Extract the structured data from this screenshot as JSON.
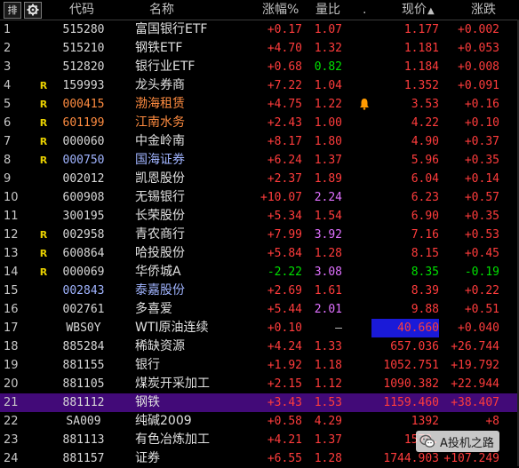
{
  "header": {
    "sort_button": "排",
    "settings_icon": "gear-icon",
    "code": "代码",
    "name": "名称",
    "pct": "涨幅%",
    "vol_ratio": "量比",
    "dot": ".",
    "price": "现价",
    "price_sort_icon": "▲",
    "change": "涨跌"
  },
  "rows": [
    {
      "num": "1",
      "flag": "",
      "code": "515280",
      "code_color": "normal",
      "name": "富国银行ETF",
      "name_color": "normal",
      "pct": "+0.17",
      "pct_dir": "up",
      "vol": "1.07",
      "vol_dir": "up",
      "alert": false,
      "price": "1.177",
      "price_dir": "up",
      "chg": "+0.002",
      "chg_dir": "up"
    },
    {
      "num": "2",
      "flag": "",
      "code": "515210",
      "code_color": "normal",
      "name": "钢铁ETF",
      "name_color": "normal",
      "pct": "+4.70",
      "pct_dir": "up",
      "vol": "1.32",
      "vol_dir": "up",
      "alert": false,
      "price": "1.181",
      "price_dir": "up",
      "chg": "+0.053",
      "chg_dir": "up"
    },
    {
      "num": "3",
      "flag": "",
      "code": "512820",
      "code_color": "normal",
      "name": "银行业ETF",
      "name_color": "normal",
      "pct": "+0.68",
      "pct_dir": "up",
      "vol": "0.82",
      "vol_dir": "down",
      "alert": false,
      "price": "1.184",
      "price_dir": "up",
      "chg": "+0.008",
      "chg_dir": "up"
    },
    {
      "num": "4",
      "flag": "R",
      "code": "159993",
      "code_color": "normal",
      "name": "龙头券商",
      "name_color": "normal",
      "pct": "+7.22",
      "pct_dir": "up",
      "vol": "1.04",
      "vol_dir": "up",
      "alert": false,
      "price": "1.352",
      "price_dir": "up",
      "chg": "+0.091",
      "chg_dir": "up"
    },
    {
      "num": "5",
      "flag": "R",
      "code": "000415",
      "code_color": "orange",
      "name": "渤海租赁",
      "name_color": "orange",
      "pct": "+4.75",
      "pct_dir": "up",
      "vol": "1.22",
      "vol_dir": "up",
      "alert": true,
      "price": "3.53",
      "price_dir": "up",
      "chg": "+0.16",
      "chg_dir": "up"
    },
    {
      "num": "6",
      "flag": "R",
      "code": "601199",
      "code_color": "orange",
      "name": "江南水务",
      "name_color": "orange",
      "pct": "+2.43",
      "pct_dir": "up",
      "vol": "1.00",
      "vol_dir": "up",
      "alert": false,
      "price": "4.22",
      "price_dir": "up",
      "chg": "+0.10",
      "chg_dir": "up"
    },
    {
      "num": "7",
      "flag": "R",
      "code": "000060",
      "code_color": "normal",
      "name": "中金岭南",
      "name_color": "normal",
      "pct": "+8.17",
      "pct_dir": "up",
      "vol": "1.80",
      "vol_dir": "up",
      "alert": false,
      "price": "4.90",
      "price_dir": "up",
      "chg": "+0.37",
      "chg_dir": "up"
    },
    {
      "num": "8",
      "flag": "R",
      "code": "000750",
      "code_color": "blue",
      "name": "国海证券",
      "name_color": "blue",
      "pct": "+6.24",
      "pct_dir": "up",
      "vol": "1.37",
      "vol_dir": "up",
      "alert": false,
      "price": "5.96",
      "price_dir": "up",
      "chg": "+0.35",
      "chg_dir": "up"
    },
    {
      "num": "9",
      "flag": "",
      "code": "002012",
      "code_color": "normal",
      "name": "凯恩股份",
      "name_color": "normal",
      "pct": "+2.37",
      "pct_dir": "up",
      "vol": "1.89",
      "vol_dir": "up",
      "alert": false,
      "price": "6.04",
      "price_dir": "up",
      "chg": "+0.14",
      "chg_dir": "up"
    },
    {
      "num": "10",
      "flag": "",
      "code": "600908",
      "code_color": "normal",
      "name": "无锡银行",
      "name_color": "normal",
      "pct": "+10.07",
      "pct_dir": "up",
      "vol": "2.24",
      "vol_dir": "purple",
      "alert": false,
      "price": "6.23",
      "price_dir": "up",
      "chg": "+0.57",
      "chg_dir": "up"
    },
    {
      "num": "11",
      "flag": "",
      "code": "300195",
      "code_color": "normal",
      "name": "长荣股份",
      "name_color": "normal",
      "pct": "+5.34",
      "pct_dir": "up",
      "vol": "1.54",
      "vol_dir": "up",
      "alert": false,
      "price": "6.90",
      "price_dir": "up",
      "chg": "+0.35",
      "chg_dir": "up"
    },
    {
      "num": "12",
      "flag": "R",
      "code": "002958",
      "code_color": "normal",
      "name": "青农商行",
      "name_color": "normal",
      "pct": "+7.99",
      "pct_dir": "up",
      "vol": "3.92",
      "vol_dir": "purple",
      "alert": false,
      "price": "7.16",
      "price_dir": "up",
      "chg": "+0.53",
      "chg_dir": "up"
    },
    {
      "num": "13",
      "flag": "R",
      "code": "600864",
      "code_color": "normal",
      "name": "哈投股份",
      "name_color": "normal",
      "pct": "+5.84",
      "pct_dir": "up",
      "vol": "1.28",
      "vol_dir": "up",
      "alert": false,
      "price": "8.15",
      "price_dir": "up",
      "chg": "+0.45",
      "chg_dir": "up"
    },
    {
      "num": "14",
      "flag": "R",
      "code": "000069",
      "code_color": "normal",
      "name": "华侨城A",
      "name_color": "normal",
      "pct": "-2.22",
      "pct_dir": "down",
      "vol": "3.08",
      "vol_dir": "purple",
      "alert": false,
      "price": "8.35",
      "price_dir": "down",
      "chg": "-0.19",
      "chg_dir": "down"
    },
    {
      "num": "15",
      "flag": "",
      "code": "002843",
      "code_color": "blue",
      "name": "泰嘉股份",
      "name_color": "blue",
      "pct": "+2.69",
      "pct_dir": "up",
      "vol": "1.61",
      "vol_dir": "up",
      "alert": false,
      "price": "8.39",
      "price_dir": "up",
      "chg": "+0.22",
      "chg_dir": "up"
    },
    {
      "num": "16",
      "flag": "",
      "code": "002761",
      "code_color": "normal",
      "name": "多喜爱",
      "name_color": "normal",
      "pct": "+5.44",
      "pct_dir": "up",
      "vol": "2.01",
      "vol_dir": "purple",
      "alert": false,
      "price": "9.88",
      "price_dir": "up",
      "chg": "+0.51",
      "chg_dir": "up"
    },
    {
      "num": "17",
      "flag": "",
      "code": "WBS0Y",
      "code_color": "normal",
      "name": "WTI原油连续",
      "name_color": "normal",
      "pct": "+0.10",
      "pct_dir": "up",
      "vol": "–",
      "vol_dir": "flat",
      "alert": false,
      "price": "40.660",
      "price_dir": "box",
      "chg": "+0.040",
      "chg_dir": "up"
    },
    {
      "num": "18",
      "flag": "",
      "code": "885284",
      "code_color": "normal",
      "name": "稀缺资源",
      "name_color": "normal",
      "pct": "+4.24",
      "pct_dir": "up",
      "vol": "1.33",
      "vol_dir": "up",
      "alert": false,
      "price": "657.036",
      "price_dir": "up",
      "chg": "+26.744",
      "chg_dir": "up"
    },
    {
      "num": "19",
      "flag": "",
      "code": "881155",
      "code_color": "normal",
      "name": "银行",
      "name_color": "normal",
      "pct": "+1.92",
      "pct_dir": "up",
      "vol": "1.18",
      "vol_dir": "up",
      "alert": false,
      "price": "1052.751",
      "price_dir": "up",
      "chg": "+19.792",
      "chg_dir": "up"
    },
    {
      "num": "20",
      "flag": "",
      "code": "881105",
      "code_color": "normal",
      "name": "煤炭开采加工",
      "name_color": "normal",
      "pct": "+2.15",
      "pct_dir": "up",
      "vol": "1.12",
      "vol_dir": "up",
      "alert": false,
      "price": "1090.382",
      "price_dir": "up",
      "chg": "+22.944",
      "chg_dir": "up"
    },
    {
      "num": "21",
      "flag": "",
      "code": "881112",
      "code_color": "normal",
      "name": "钢铁",
      "name_color": "normal",
      "pct": "+3.43",
      "pct_dir": "up",
      "vol": "1.53",
      "vol_dir": "up",
      "alert": false,
      "price": "1159.460",
      "price_dir": "up",
      "chg": "+38.407",
      "chg_dir": "up",
      "selected": true
    },
    {
      "num": "22",
      "flag": "",
      "code": "SA009",
      "code_color": "normal",
      "name": "纯碱2009",
      "name_color": "normal",
      "pct": "+0.58",
      "pct_dir": "up",
      "vol": "4.29",
      "vol_dir": "up",
      "alert": false,
      "price": "1392",
      "price_dir": "up",
      "chg": "+8",
      "chg_dir": "up"
    },
    {
      "num": "23",
      "flag": "",
      "code": "881113",
      "code_color": "normal",
      "name": "有色冶炼加工",
      "name_color": "normal",
      "pct": "+4.21",
      "pct_dir": "up",
      "vol": "1.37",
      "vol_dir": "up",
      "alert": false,
      "price": "1579.",
      "price_dir": "up",
      "chg": "",
      "chg_dir": "up"
    },
    {
      "num": "24",
      "flag": "",
      "code": "881157",
      "code_color": "normal",
      "name": "证券",
      "name_color": "normal",
      "pct": "+6.55",
      "pct_dir": "up",
      "vol": "1.28",
      "vol_dir": "up",
      "alert": false,
      "price": "1744.903",
      "price_dir": "up",
      "chg": "+107.249",
      "chg_dir": "up"
    }
  ],
  "watermark": {
    "text": "A投机之路",
    "icon": "wechat-icon"
  }
}
